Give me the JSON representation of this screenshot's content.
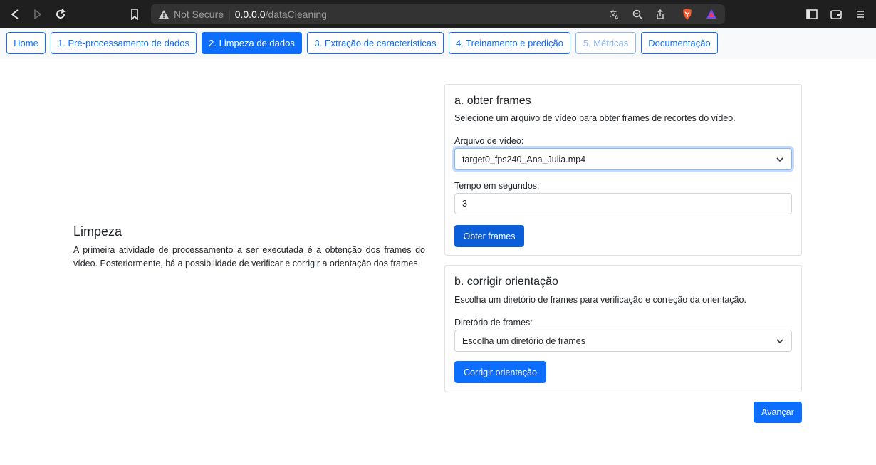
{
  "browser": {
    "security_label": "Not Secure",
    "url_host": "0.0.0.0",
    "url_path": "/dataCleaning",
    "icons": [
      "back-icon",
      "forward-icon",
      "reload-icon",
      "bookmark-icon",
      "warning-icon",
      "translate-icon",
      "zoom-icon",
      "share-icon",
      "brave-shield-icon",
      "brave-rewards-icon",
      "sidebar-icon",
      "wallet-icon",
      "menu-icon"
    ]
  },
  "nav": {
    "items": [
      {
        "label": "Home",
        "state": "default"
      },
      {
        "label": "1. Pré-processamento de dados",
        "state": "default"
      },
      {
        "label": "2. Limpeza de dados",
        "state": "active"
      },
      {
        "label": "3. Extração de características",
        "state": "default"
      },
      {
        "label": "4. Treinamento e predição",
        "state": "default"
      },
      {
        "label": "5. Métricas",
        "state": "disabled"
      },
      {
        "label": "Documentação",
        "state": "default"
      }
    ]
  },
  "intro": {
    "title": "Limpeza",
    "text": "A primeira atividade de processamento a ser executada é a obtenção dos frames do vídeo. Posteriormente, há a possibilidade de verificar e corrigir a orientação dos frames."
  },
  "card_a": {
    "title": "a. obter frames",
    "description": "Selecione um arquivo de vídeo para obter frames de recortes do vídeo.",
    "video_label": "Arquivo de vídeo:",
    "video_value": "target0_fps240_Ana_Julia.mp4",
    "time_label": "Tempo em segundos:",
    "time_value": "3",
    "button": "Obter frames"
  },
  "card_b": {
    "title": "b. corrigir orientação",
    "description": "Escolha um diretório de frames para verificação e correção da orientação.",
    "dir_label": "Diretório de frames:",
    "dir_value": "Escolha um diretório de frames",
    "button": "Corrigir orientação"
  },
  "footer": {
    "next_button": "Avançar"
  },
  "colors": {
    "primary": "#0d6efd",
    "primary_dark": "#0b5ed7",
    "chrome_bg": "#1f1f1f"
  }
}
